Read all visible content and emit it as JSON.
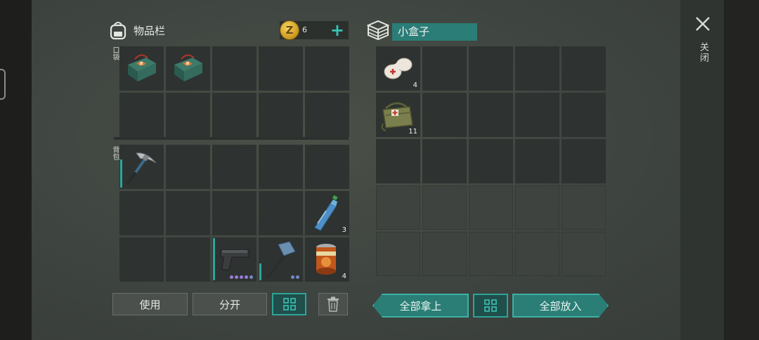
{
  "inventory": {
    "title": "物品栏",
    "pocket_label": "口袋",
    "backpack_label": "背包"
  },
  "currency": {
    "count": "6",
    "coin_symbol": "Z",
    "add_label": "+"
  },
  "container": {
    "title": "小盒子"
  },
  "close": {
    "label": "关闭"
  },
  "pocket_items": [
    {
      "name": "first-aid-kit",
      "slot": 0
    },
    {
      "name": "first-aid-kit",
      "slot": 1
    }
  ],
  "backpack_items": [
    {
      "name": "pickaxe",
      "slot": 0
    },
    {
      "name": "water-bottle",
      "slot": 9,
      "qty": "3"
    },
    {
      "name": "pistol",
      "slot": 12
    },
    {
      "name": "sledgehammer",
      "slot": 13
    },
    {
      "name": "canned-food",
      "slot": 14,
      "qty": "4"
    }
  ],
  "box_items": [
    {
      "name": "bandage",
      "slot": 0,
      "qty": "4"
    },
    {
      "name": "medical-bag",
      "slot": 5,
      "qty": "11"
    }
  ],
  "buttons": {
    "use": "使用",
    "split": "分开",
    "take_all": "全部拿上",
    "put_all": "全部放入"
  }
}
